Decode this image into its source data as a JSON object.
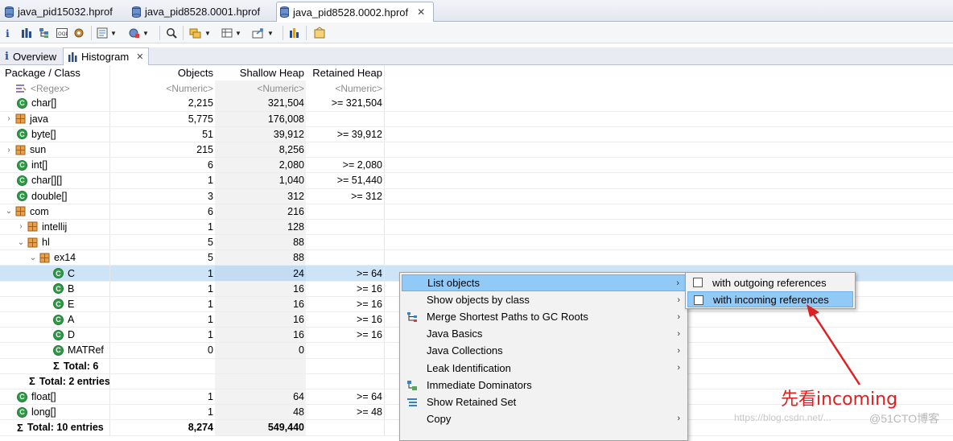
{
  "editor_tabs": [
    {
      "label": "java_pid15032.hprof",
      "active": false
    },
    {
      "label": "java_pid8528.0001.hprof",
      "active": false
    },
    {
      "label": "java_pid8528.0002.hprof",
      "active": true
    }
  ],
  "view_tabs": [
    {
      "label": "Overview",
      "icon": "info-icon"
    },
    {
      "label": "Histogram",
      "icon": "histogram-icon",
      "active": true
    }
  ],
  "table": {
    "columns": [
      "Package / Class",
      "Objects",
      "Shallow Heap",
      "Retained Heap"
    ],
    "filters": {
      "name": "<Regex>",
      "objects": "<Numeric>",
      "shallow": "<Numeric>",
      "retained": "<Numeric>"
    },
    "rows": [
      {
        "name": "char[]",
        "kind": "class",
        "indent": 1,
        "expander": "",
        "objects": "2,215",
        "shallow": "321,504",
        "retained": ">= 321,504"
      },
      {
        "name": "java",
        "kind": "package",
        "indent": 0,
        "expander": "›",
        "objects": "5,775",
        "shallow": "176,008",
        "retained": ""
      },
      {
        "name": "byte[]",
        "kind": "class",
        "indent": 1,
        "expander": "",
        "objects": "51",
        "shallow": "39,912",
        "retained": ">= 39,912"
      },
      {
        "name": "sun",
        "kind": "package",
        "indent": 0,
        "expander": "›",
        "objects": "215",
        "shallow": "8,256",
        "retained": ""
      },
      {
        "name": "int[]",
        "kind": "class",
        "indent": 1,
        "expander": "",
        "objects": "6",
        "shallow": "2,080",
        "retained": ">= 2,080"
      },
      {
        "name": "char[][]",
        "kind": "class",
        "indent": 1,
        "expander": "",
        "objects": "1",
        "shallow": "1,040",
        "retained": ">= 51,440"
      },
      {
        "name": "double[]",
        "kind": "class",
        "indent": 1,
        "expander": "",
        "objects": "3",
        "shallow": "312",
        "retained": ">= 312"
      },
      {
        "name": "com",
        "kind": "package",
        "indent": 0,
        "expander": "⌄",
        "objects": "6",
        "shallow": "216",
        "retained": ""
      },
      {
        "name": "intellij",
        "kind": "package",
        "indent": 1,
        "expander": "›",
        "objects": "1",
        "shallow": "128",
        "retained": ""
      },
      {
        "name": "hl",
        "kind": "package",
        "indent": 1,
        "expander": "⌄",
        "objects": "5",
        "shallow": "88",
        "retained": ""
      },
      {
        "name": "ex14",
        "kind": "package",
        "indent": 2,
        "expander": "⌄",
        "objects": "5",
        "shallow": "88",
        "retained": ""
      },
      {
        "name": "C",
        "kind": "class",
        "indent": 4,
        "expander": "",
        "objects": "1",
        "shallow": "24",
        "retained": ">= 64",
        "selected": true
      },
      {
        "name": "B",
        "kind": "class",
        "indent": 4,
        "expander": "",
        "objects": "1",
        "shallow": "16",
        "retained": ">= 16"
      },
      {
        "name": "E",
        "kind": "class",
        "indent": 4,
        "expander": "",
        "objects": "1",
        "shallow": "16",
        "retained": ">= 16"
      },
      {
        "name": "A",
        "kind": "class",
        "indent": 4,
        "expander": "",
        "objects": "1",
        "shallow": "16",
        "retained": ">= 16"
      },
      {
        "name": "D",
        "kind": "class",
        "indent": 4,
        "expander": "",
        "objects": "1",
        "shallow": "16",
        "retained": ">= 16"
      },
      {
        "name": "MATRef",
        "kind": "class",
        "indent": 4,
        "expander": "",
        "objects": "0",
        "shallow": "0",
        "retained": ""
      },
      {
        "name": "Total: 6",
        "kind": "total",
        "indent": 4,
        "expander": "",
        "objects": "",
        "shallow": "",
        "retained": ""
      },
      {
        "name": "Total: 2 entries",
        "kind": "total",
        "indent": 2,
        "expander": "",
        "objects": "",
        "shallow": "",
        "retained": ""
      },
      {
        "name": "float[]",
        "kind": "class",
        "indent": 1,
        "expander": "",
        "objects": "1",
        "shallow": "64",
        "retained": ">= 64"
      },
      {
        "name": "long[]",
        "kind": "class",
        "indent": 1,
        "expander": "",
        "objects": "1",
        "shallow": "48",
        "retained": ">= 48"
      },
      {
        "name": "Total: 10 entries",
        "kind": "total",
        "indent": 1,
        "expander": "",
        "objects": "8,274",
        "shallow": "549,440",
        "retained": ""
      }
    ]
  },
  "context_menu": {
    "items": [
      {
        "label": "List objects",
        "icon": "",
        "submenu": true,
        "highlighted": true
      },
      {
        "label": "Show objects by class",
        "icon": "",
        "submenu": true
      },
      {
        "label": "Merge Shortest Paths to GC Roots",
        "icon": "merge-paths-icon",
        "submenu": true
      },
      {
        "label": "Java Basics",
        "icon": "",
        "submenu": true
      },
      {
        "label": "Java Collections",
        "icon": "",
        "submenu": true
      },
      {
        "label": "Leak Identification",
        "icon": "",
        "submenu": true
      },
      {
        "label": "Immediate Dominators",
        "icon": "dominators-icon",
        "submenu": false
      },
      {
        "label": "Show Retained Set",
        "icon": "retained-set-icon",
        "submenu": false
      },
      {
        "label": "Copy",
        "icon": "",
        "submenu": true
      }
    ]
  },
  "sub_menu": {
    "items": [
      {
        "label": "with outgoing references",
        "highlighted": false
      },
      {
        "label": "with incoming references",
        "highlighted": true
      }
    ]
  },
  "annotation": {
    "text": "先看incoming",
    "color": "#e02020"
  },
  "watermark": {
    "url": "https://blog.csdn.net/...",
    "brand": "@51CTO博客"
  },
  "colors": {
    "selection": "#cde4f7",
    "menu_highlight": "#91c9f7",
    "class_icon": "#2e9a45",
    "package_icon": "#c8741a"
  }
}
